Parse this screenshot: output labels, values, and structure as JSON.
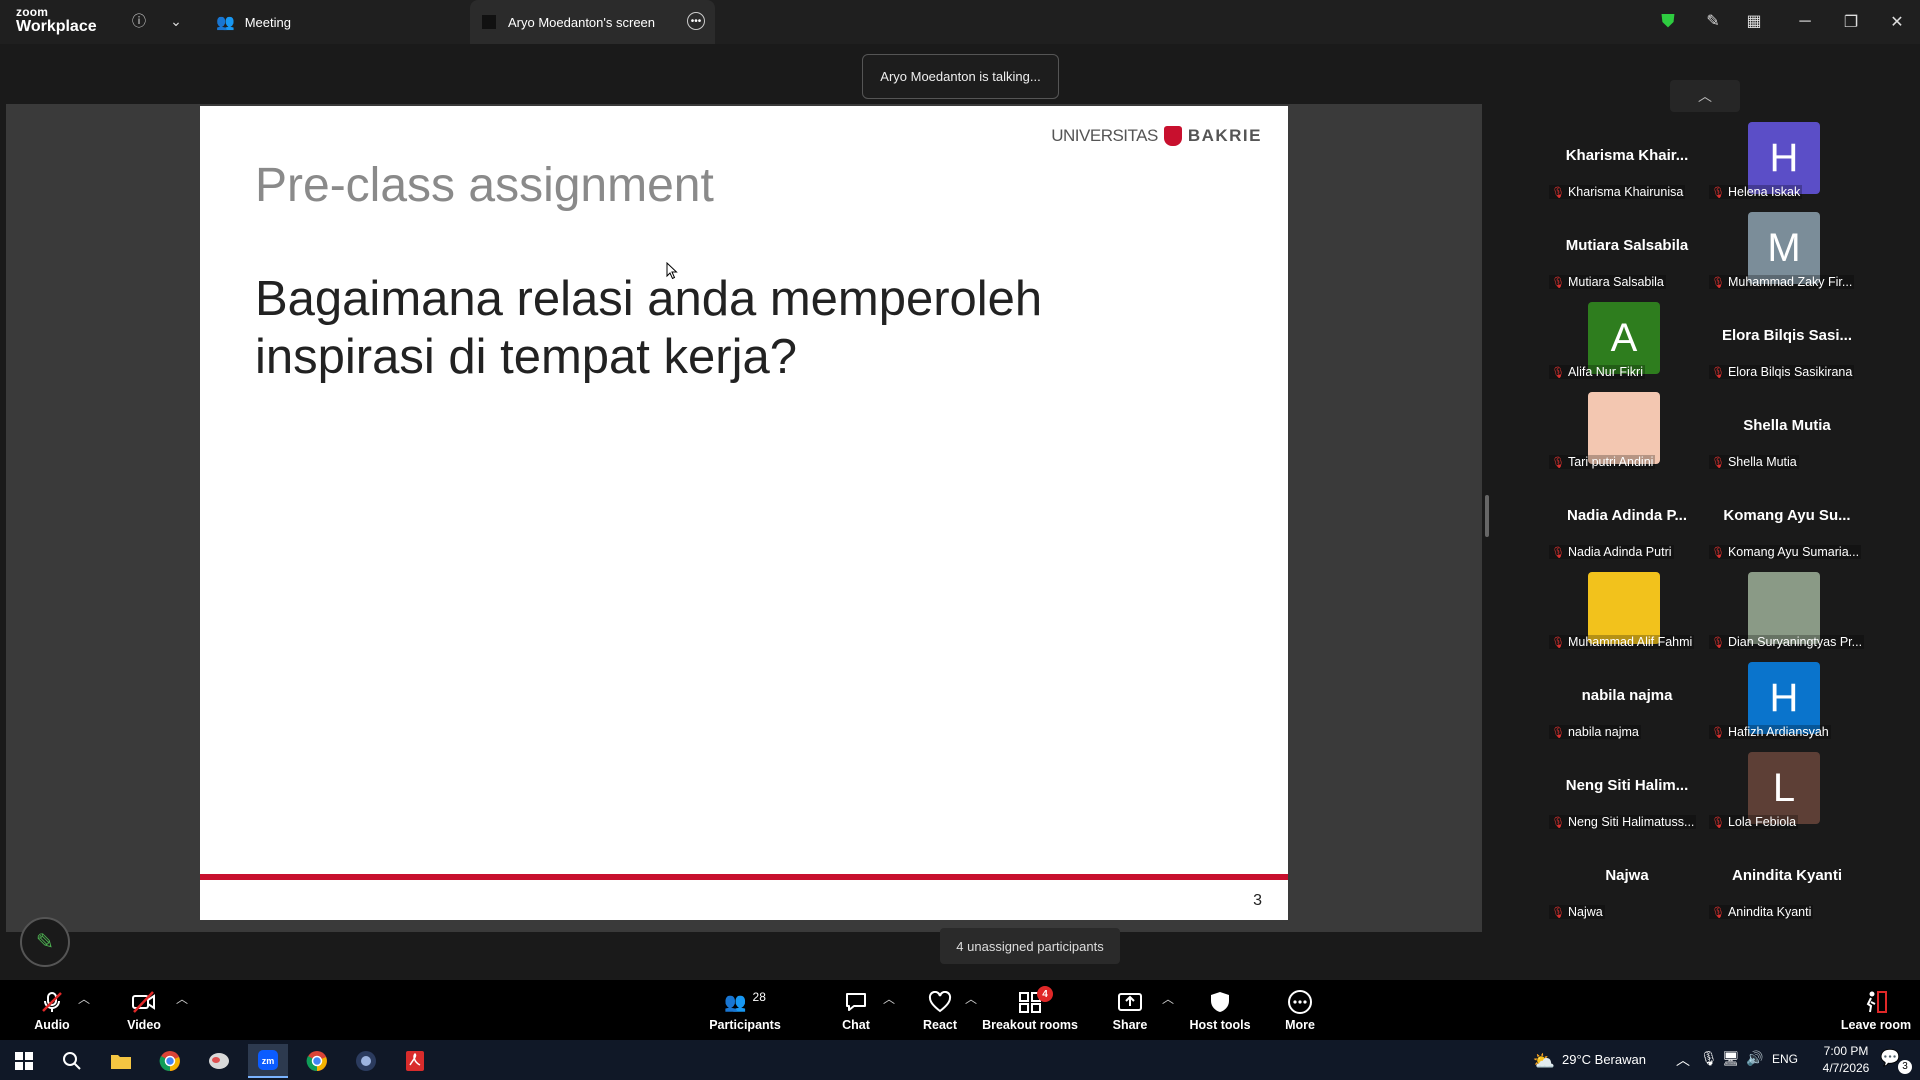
{
  "app": {
    "logo_line1": "zoom",
    "logo_line2": "Workplace"
  },
  "tabs": [
    {
      "label": "Meeting"
    },
    {
      "label": "Aryo Moedanton's screen"
    }
  ],
  "talking_indicator": "Aryo Moedanton is talking...",
  "slide": {
    "title": "Pre-class assignment",
    "body": "Bagaimana relasi anda memperoleh inspirasi di tempat kerja?",
    "logo_universitas": "UNIVERSITAS",
    "logo_bakrie": "BAKRIE",
    "page_number": "3",
    "accent_color": "#c8102e"
  },
  "participants": [
    {
      "big_name": "Kharisma Khair...",
      "name": "Kharisma Khairunisa",
      "avatar": null
    },
    {
      "big_name": "",
      "name": "Helena Iskak",
      "avatar": "H",
      "avatar_color": "#5b4ec7"
    },
    {
      "big_name": "Mutiara Salsabila",
      "name": "Mutiara Salsabila",
      "avatar": null
    },
    {
      "big_name": "",
      "name": "Muhammad Zaky Fir...",
      "avatar": "M",
      "avatar_color": "#7b8d99"
    },
    {
      "big_name": "",
      "name": "Alifa Nur Fikri",
      "avatar": "A",
      "avatar_color": "#2e7d1e"
    },
    {
      "big_name": "Elora Bilqis Sasi...",
      "name": "Elora Bilqis Sasikirana",
      "avatar": null
    },
    {
      "big_name": "",
      "name": "Tari putri Andini",
      "avatar": "photo",
      "avatar_color": "#f3c7b1"
    },
    {
      "big_name": "Shella Mutia",
      "name": "Shella Mutia",
      "avatar": null
    },
    {
      "big_name": "Nadia Adinda P...",
      "name": "Nadia Adinda Putri",
      "avatar": null
    },
    {
      "big_name": "Komang Ayu Su...",
      "name": "Komang Ayu Sumaria...",
      "avatar": null
    },
    {
      "big_name": "",
      "name": "Muhammad Alif Fahmi",
      "avatar": "photo",
      "avatar_color": "#f2c21c"
    },
    {
      "big_name": "",
      "name": "Dian Suryaningtyas Pr...",
      "avatar": "photo",
      "avatar_color": "#8a9a86"
    },
    {
      "big_name": "nabila najma",
      "name": "nabila najma",
      "avatar": null
    },
    {
      "big_name": "",
      "name": "Hafizh Ardiansyah",
      "avatar": "H",
      "avatar_color": "#0a74cc"
    },
    {
      "big_name": "Neng Siti Halim...",
      "name": "Neng Siti Halimatuss...",
      "avatar": null
    },
    {
      "big_name": "",
      "name": "Lola Febiola",
      "avatar": "L",
      "avatar_color": "#5d3f36"
    },
    {
      "big_name": "Najwa",
      "name": "Najwa",
      "avatar": null
    },
    {
      "big_name": "Anindita Kyanti",
      "name": "Anindita Kyanti",
      "avatar": null
    }
  ],
  "unassigned_tooltip": "4 unassigned participants",
  "toolbar": {
    "audio": "Audio",
    "video": "Video",
    "participants": "Participants",
    "participants_count": "28",
    "chat": "Chat",
    "react": "React",
    "breakout_rooms": "Breakout rooms",
    "breakout_badge": "4",
    "share": "Share",
    "host_tools": "Host tools",
    "more": "More",
    "leave": "Leave room"
  },
  "taskbar": {
    "weather": "29°C  Berawan",
    "language": "ENG",
    "time": "7:00 PM",
    "date": "4/7/2026",
    "notifications": "3"
  }
}
